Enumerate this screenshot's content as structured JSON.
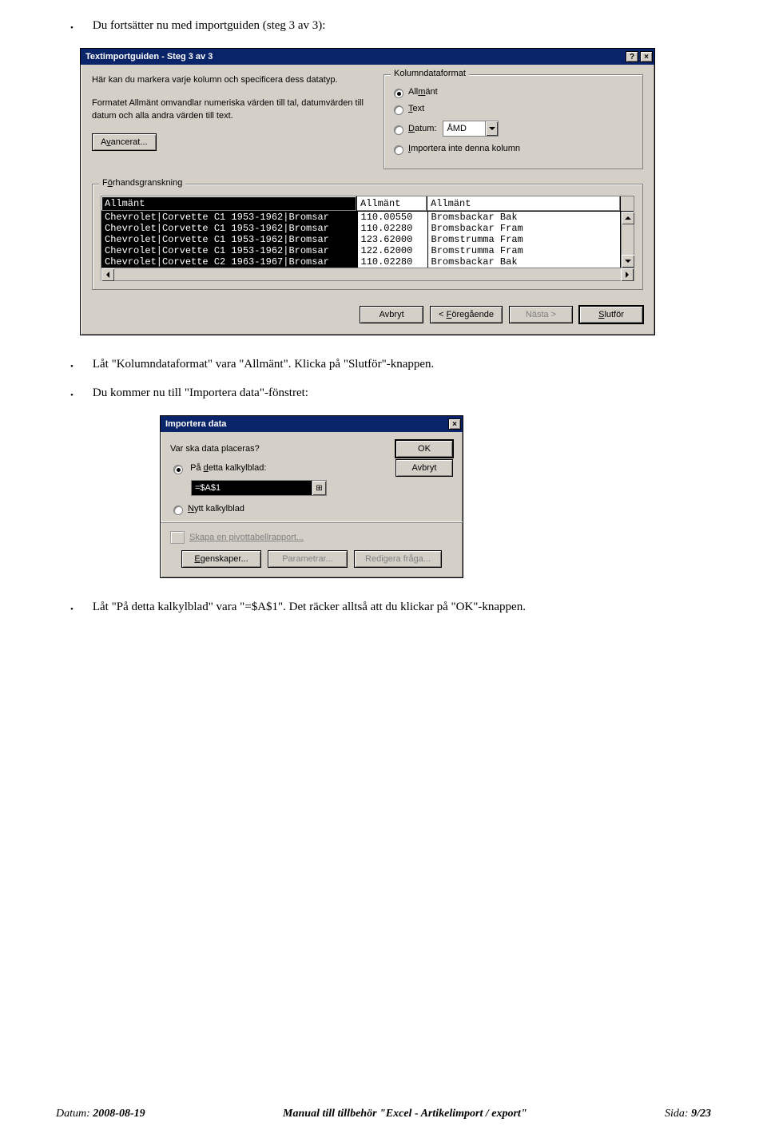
{
  "doc": {
    "bullet1": "Du fortsätter nu med importguiden (steg 3 av 3):",
    "bullet2": "Låt \"Kolumndataformat\" vara \"Allmänt\". Klicka på \"Slutför\"-knappen.",
    "bullet3": "Du kommer nu till \"Importera data\"-fönstret:",
    "bullet4": "Låt \"På detta kalkylblad\" vara \"=$A$1\". Det räcker alltså att du klickar på \"OK\"-knappen."
  },
  "wizard": {
    "title": "Textimportguiden - Steg 3 av 3",
    "help_btn": "?",
    "close_btn": "×",
    "intro1": "Här kan du markera varje kolumn och specificera dess datatyp.",
    "intro2": "Formatet Allmänt omvandlar numeriska värden till tal, datumvärden till datum och alla andra värden till text.",
    "advanced": "Avancerat...",
    "group_legend": "Kolumndataformat",
    "opt_general": "Allmänt",
    "opt_text": "Text",
    "opt_date": "Datum:",
    "date_value": "ÅMD",
    "opt_skip": "Importera inte denna kolumn",
    "preview_legend": "Förhandsgranskning",
    "hdr1": "Allmänt",
    "hdr2": "Allmänt",
    "hdr3": "Allmänt",
    "rows": [
      {
        "c1": "Chevrolet|Corvette C1 1953-1962|Bromsar",
        "c2": "110.00550",
        "c3": "Bromsbackar Bak"
      },
      {
        "c1": "Chevrolet|Corvette C1 1953-1962|Bromsar",
        "c2": "110.02280",
        "c3": "Bromsbackar Fram"
      },
      {
        "c1": "Chevrolet|Corvette C1 1953-1962|Bromsar",
        "c2": "123.62000",
        "c3": "Bromstrumma Fram"
      },
      {
        "c1": "Chevrolet|Corvette C1 1953-1962|Bromsar",
        "c2": "122.62000",
        "c3": "Bromstrumma Fram"
      },
      {
        "c1": "Chevrolet|Corvette C2 1963-1967|Bromsar",
        "c2": "110.02280",
        "c3": "Bromsbackar Bak"
      }
    ],
    "btn_cancel": "Avbryt",
    "btn_back": "< Föregående",
    "btn_next": "Nästa >",
    "btn_finish": "Slutför"
  },
  "import": {
    "title": "Importera data",
    "close_btn": "×",
    "question": "Var ska data placeras?",
    "opt_this_sheet": "På detta kalkylblad:",
    "cellref": "=$A$1",
    "opt_new_sheet": "Nytt kalkylblad",
    "pivot_link": "Skapa en pivottabellrapport...",
    "btn_ok": "OK",
    "btn_cancel": "Avbryt",
    "btn_props": "Egenskaper...",
    "btn_params": "Parametrar...",
    "btn_edit": "Redigera fråga..."
  },
  "footer": {
    "date_label": "Datum: ",
    "date": "2008-08-19",
    "title": "Manual till tillbehör \"Excel - Artikelimport / export\"",
    "page_label": "Sida: ",
    "page": "9/23"
  }
}
